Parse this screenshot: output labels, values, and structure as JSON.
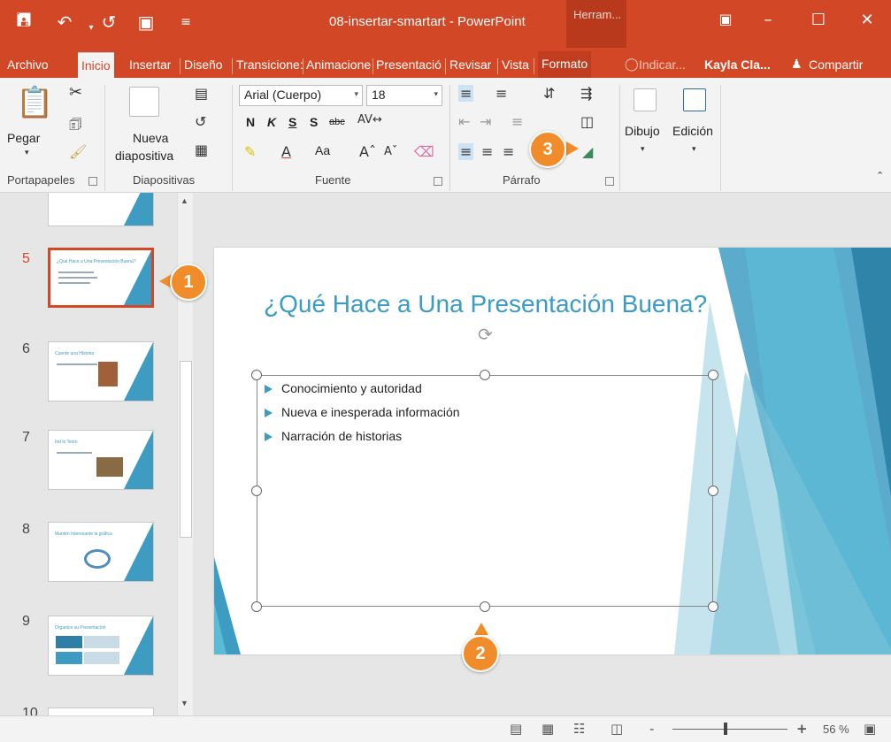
{
  "titlebar": {
    "title": "08-insertar-smartart  -  PowerPoint",
    "tools_tab": "Herram...",
    "save_icon": "save-icon",
    "undo_icon": "undo-icon",
    "redo_icon": "redo-icon"
  },
  "menu": {
    "tabs": [
      "Archivo",
      "Inicio",
      "Insertar",
      "Diseño",
      "Transicione:",
      "Animacione",
      "Presentació",
      "Revisar",
      "Vista",
      "Formato"
    ],
    "active": "Inicio",
    "tell_me": "Indicar...",
    "user": "Kayla Cla...",
    "share": "Compartir"
  },
  "ribbon": {
    "paste_label": "Pegar",
    "new_slide_label1": "Nueva",
    "new_slide_label2": "diapositiva",
    "font_name": "Arial (Cuerpo)",
    "font_size": "18",
    "bold": "N",
    "italic": "K",
    "underline": "S",
    "shadow": "S",
    "strike": "abc",
    "aa_label": "Aa",
    "draw_label": "Dibujo",
    "edit_label": "Edición",
    "groups": {
      "clipboard": "Portapapeles",
      "slides": "Diapositivas",
      "font": "Fuente",
      "paragraph": "Párrafo"
    }
  },
  "thumbnails": [
    {
      "num": "5",
      "title": "¿Qué Hace a Una Presentación Buena?"
    },
    {
      "num": "6",
      "title": "Cuente una Historia"
    },
    {
      "num": "7",
      "title": "Ind lo Texto"
    },
    {
      "num": "8",
      "title": "Mantén Interesante la gráfica"
    },
    {
      "num": "9",
      "title": "Organice su Presentación"
    },
    {
      "num": "10",
      "title": ""
    }
  ],
  "slide": {
    "title": "¿Qué Hace a Una Presentación Buena?",
    "bullets": [
      "Conocimiento y autoridad",
      "Nueva e inesperada información",
      "Narración de historias"
    ]
  },
  "statusbar": {
    "zoom": "56 %",
    "zoom_in": "+",
    "zoom_out": "-"
  },
  "callouts": [
    "1",
    "2",
    "3"
  ],
  "colors": {
    "accent": "#d24726",
    "slide_blue": "#3a9cc3",
    "callout": "#f08c2a"
  }
}
